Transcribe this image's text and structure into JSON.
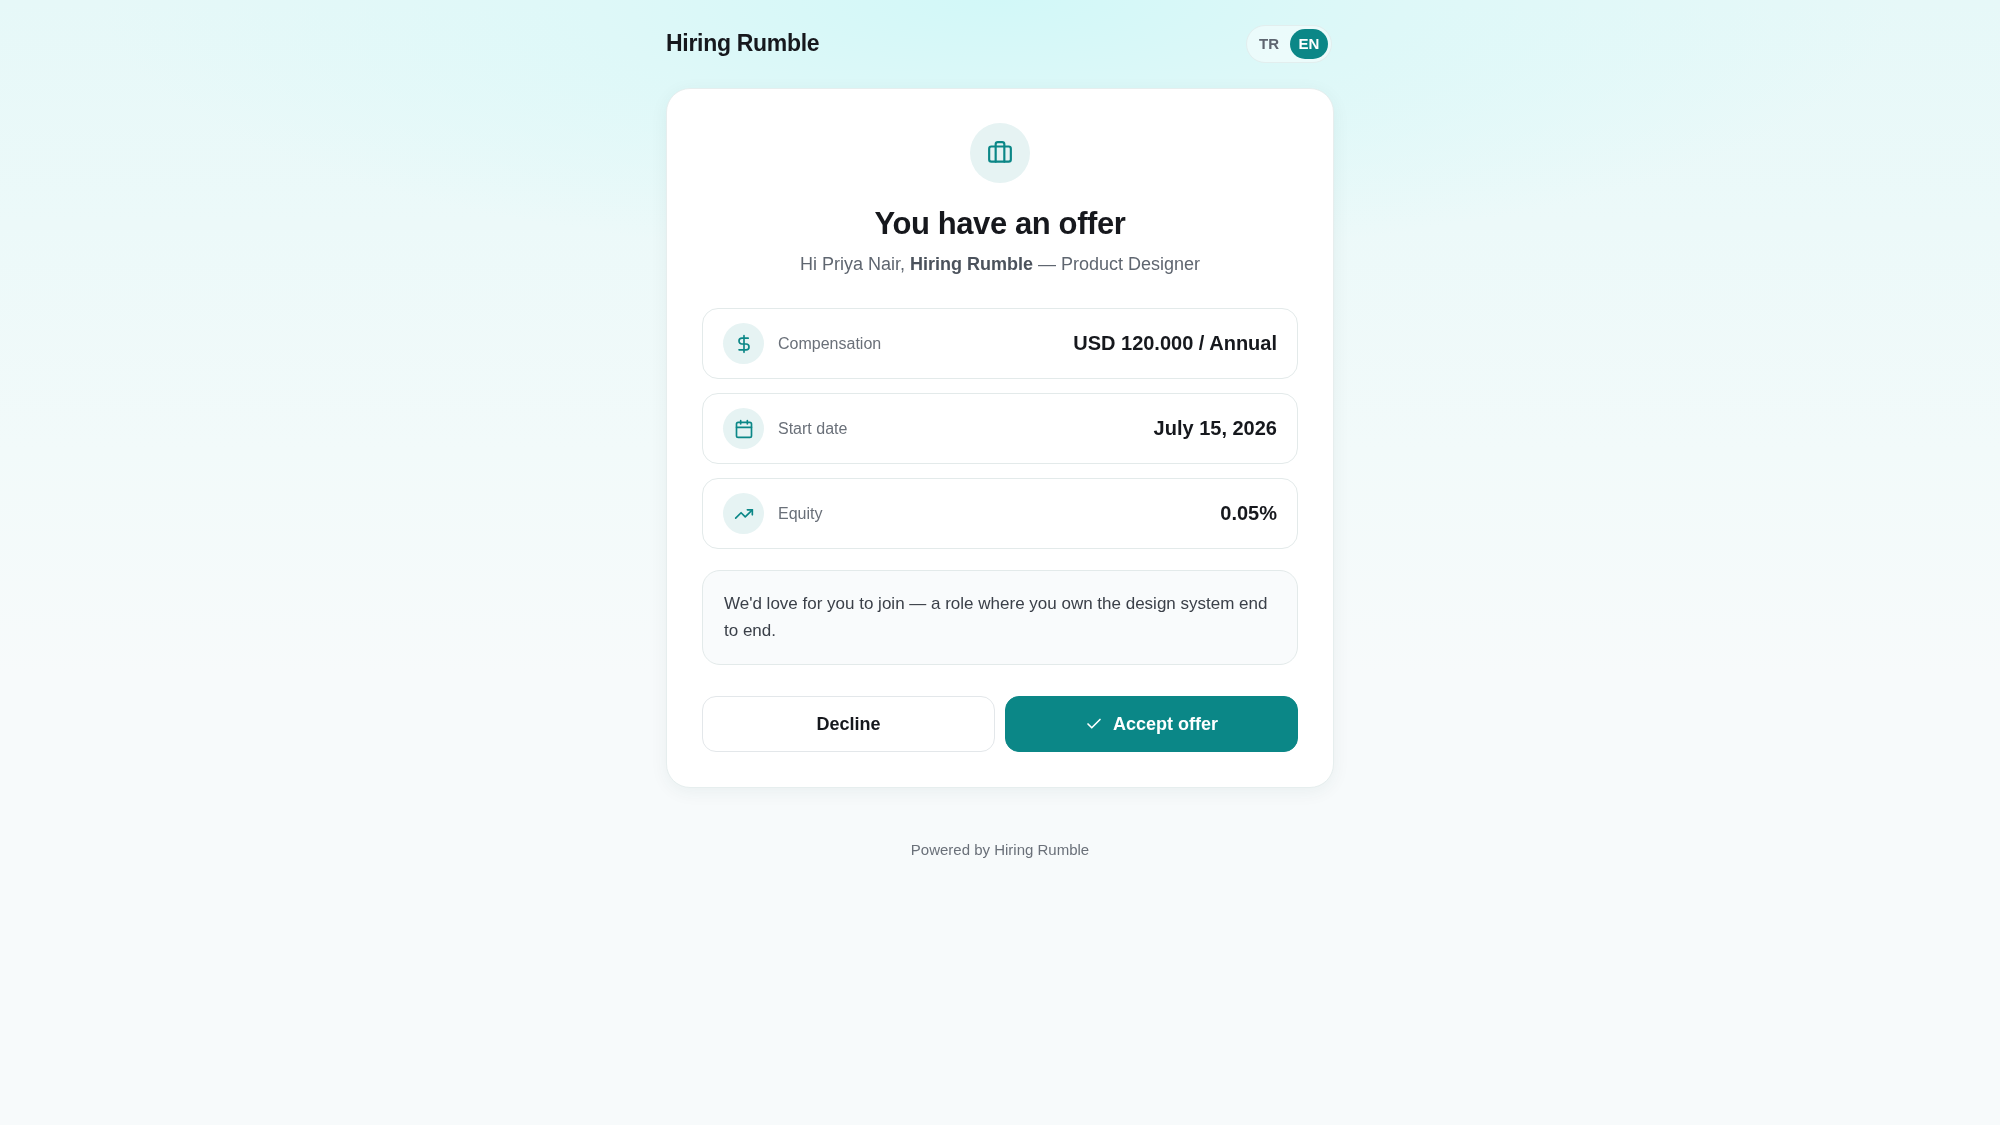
{
  "brand": "Hiring Rumble",
  "languages": [
    {
      "label": "TR",
      "selected": false
    },
    {
      "label": "EN",
      "selected": true
    }
  ],
  "offer": {
    "title": "You have an offer",
    "greeting": "Hi Priya Nair, **Hiring Rumble** — Product Designer",
    "details": [
      {
        "kind": "compensation",
        "label": "Compensation",
        "value": "USD 120.000 / Annual"
      },
      {
        "kind": "date",
        "label": "Start date",
        "value": "July 15, 2026"
      },
      {
        "kind": "equity",
        "label": "Equity",
        "value": "0.05%"
      }
    ],
    "message": "We'd love for you to join — a role where you own the design system end to end.",
    "actions": [
      {
        "kind": "secondary",
        "label": "Decline"
      },
      {
        "kind": "primary",
        "label": "Accept offer"
      }
    ]
  },
  "footer": "Powered by Hiring Rumble"
}
